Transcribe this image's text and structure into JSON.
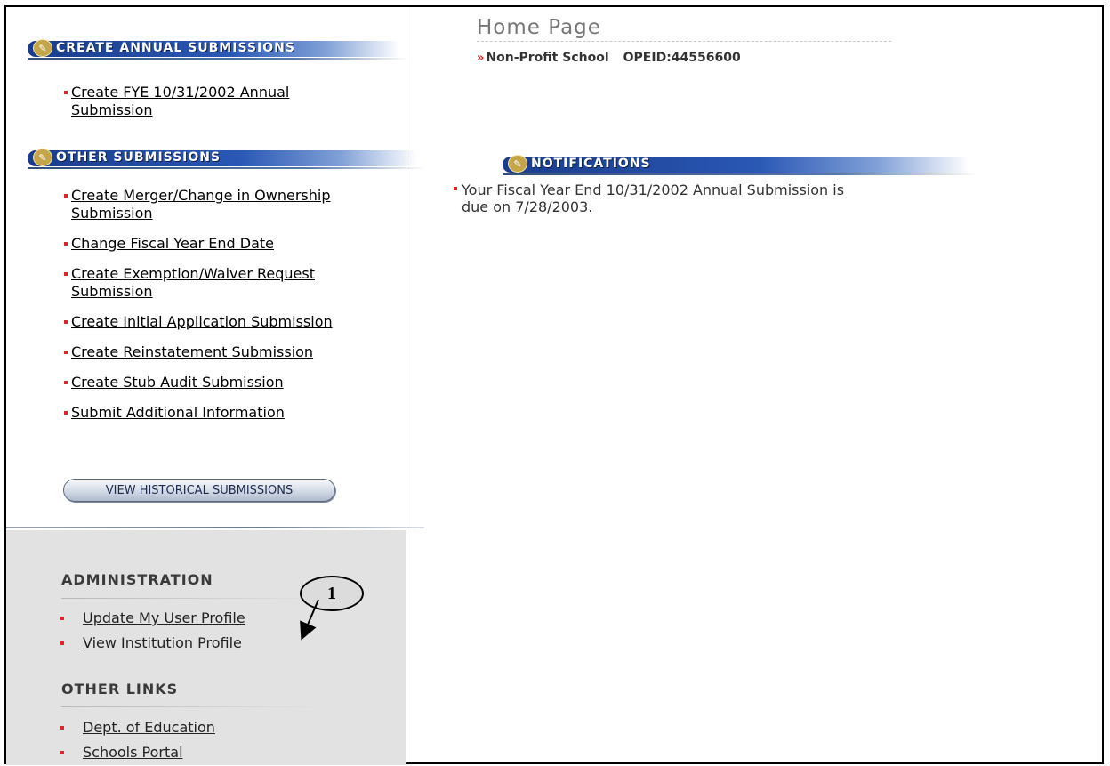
{
  "page_title": "Home Page",
  "school": {
    "name": "Non-Profit School",
    "opeid": "OPEID:44556600"
  },
  "annual_section": {
    "title": "CREATE ANNUAL SUBMISSIONS",
    "items": [
      "Create FYE 10/31/2002 Annual Submission"
    ]
  },
  "other_section": {
    "title": "OTHER SUBMISSIONS",
    "items": [
      "Create Merger/Change in Ownership Submission",
      "Change Fiscal Year End Date",
      "Create Exemption/Waiver Request Submission",
      "Create Initial Application Submission",
      "Create Reinstatement Submission",
      "Create Stub Audit Submission",
      "Submit Additional Information"
    ]
  },
  "historical_button": "VIEW HISTORICAL SUBMISSIONS",
  "administration": {
    "title": "ADMINISTRATION",
    "items": [
      "Update My User Profile",
      "View Institution Profile"
    ]
  },
  "other_links": {
    "title": "OTHER LINKS",
    "items": [
      "Dept. of Education",
      "Schools Portal"
    ]
  },
  "notifications": {
    "title": "NOTIFICATIONS",
    "text": "Your Fiscal Year End 10/31/2002 Annual Submission is due on 7/28/2003."
  },
  "callout_label": "1",
  "colors": {
    "header_blue": "#1a3c8a",
    "bullet_red": "#e0242a",
    "sidebar_gray": "#e2e2e2"
  },
  "icons": {
    "section_icon": "pencil-badge-icon",
    "chevron": "double-chevron-right-icon"
  }
}
